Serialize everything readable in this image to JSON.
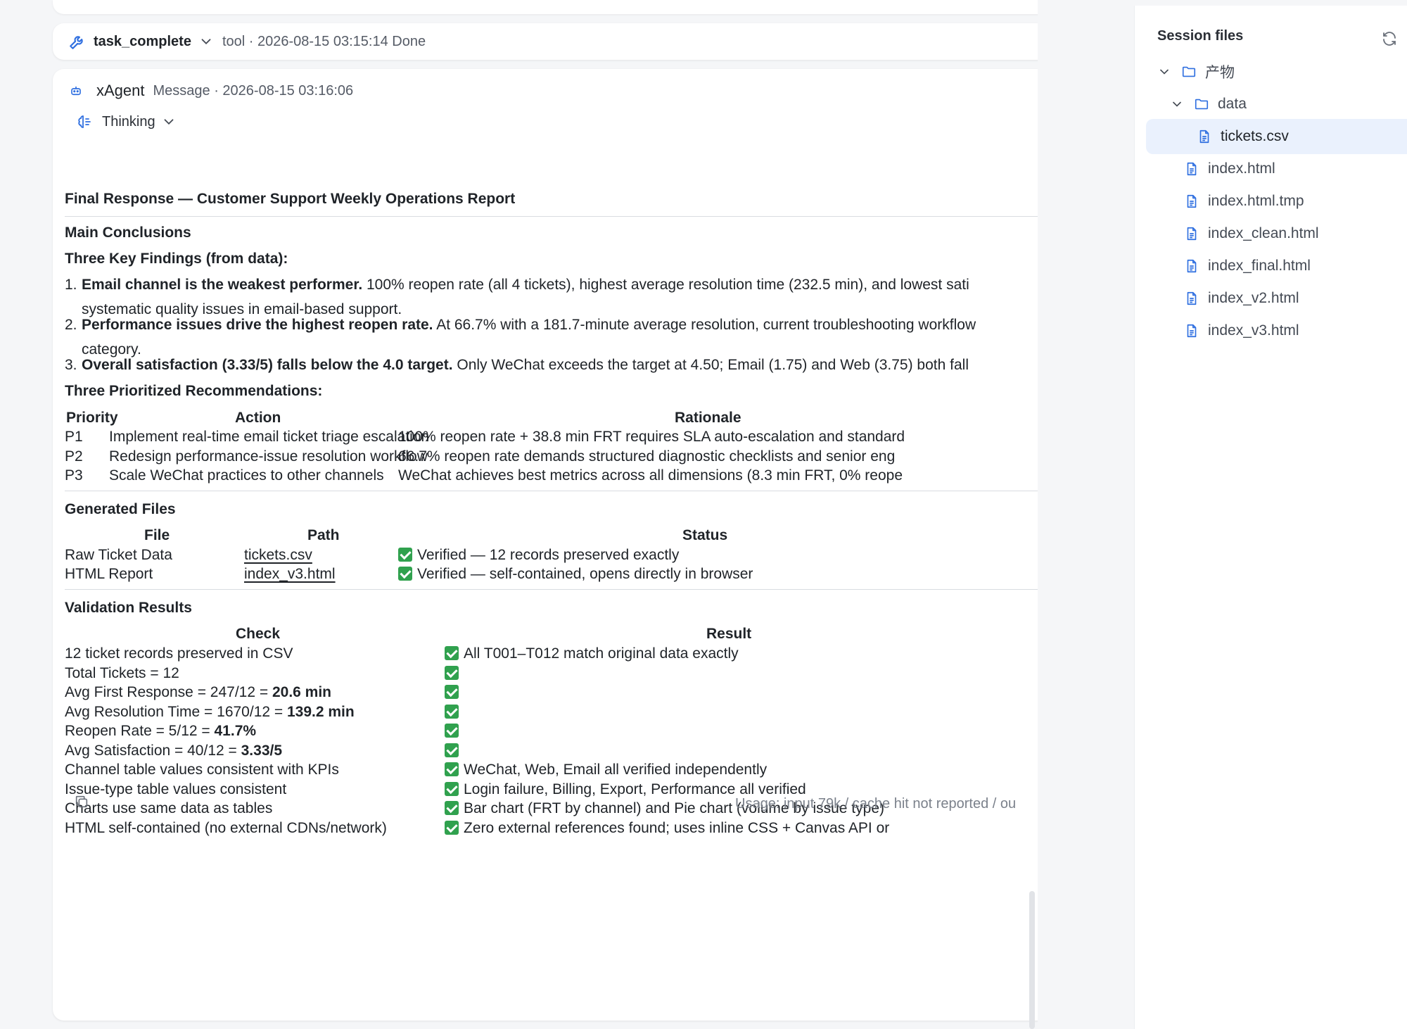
{
  "tool_call": {
    "name": "task_complete",
    "meta": "tool · 2026-08-15 03:15:14  Done"
  },
  "message": {
    "agent": "xAgent",
    "meta": "Message · 2026-08-15 03:16:06",
    "thinking_label": "Thinking",
    "title": "Final Response — Customer Support Weekly Operations Report",
    "main_conclusions": "Main Conclusions",
    "findings_heading": "Three Key Findings (from data):",
    "findings": [
      {
        "num": "1.",
        "bold": "Email channel is the weakest performer.",
        "text": " 100% reopen rate (all 4 tickets), highest average resolution time (232.5 min), and lowest sati",
        "cont": "systematic quality issues in email-based support."
      },
      {
        "num": "2.",
        "bold": "Performance issues drive the highest reopen rate.",
        "text": " At 66.7% with a 181.7-minute average resolution, current troubleshooting workflow",
        "cont": "category."
      },
      {
        "num": "3.",
        "bold": "Overall satisfaction (3.33/5) falls below the 4.0 target.",
        "text": " Only WeChat exceeds the target at 4.50; Email (1.75) and Web (3.75) both fall",
        "cont": ""
      }
    ],
    "recs_heading": "Three Prioritized Recommendations:",
    "recs_headers": [
      "Priority",
      "Action",
      "Rationale"
    ],
    "recs": [
      {
        "priority": "P1",
        "action": "Implement real-time email ticket triage escalation",
        "rationale": "100% reopen rate + 38.8 min FRT requires SLA auto-escalation and standard"
      },
      {
        "priority": "P2",
        "action": "Redesign performance-issue resolution workflow",
        "rationale": "66.7% reopen rate demands structured diagnostic checklists and senior eng"
      },
      {
        "priority": "P3",
        "action": "Scale WeChat practices to other channels",
        "rationale": "WeChat achieves best metrics across all dimensions (8.3 min FRT, 0% reope"
      }
    ],
    "files_heading": "Generated Files",
    "files_headers": [
      "File",
      "Path",
      "Status"
    ],
    "files": [
      {
        "file": "Raw Ticket Data",
        "path": "tickets.csv",
        "status": "Verified — 12 records preserved exactly"
      },
      {
        "file": "HTML Report",
        "path": "index_v3.html",
        "status": "Verified — self-contained, opens directly in browser"
      }
    ],
    "validation_heading": "Validation Results",
    "validation_headers": [
      "Check",
      "Result"
    ],
    "validation": [
      {
        "check": "12 ticket records preserved in CSV",
        "check_bold": "",
        "result": "All T001–T012 match original data exactly"
      },
      {
        "check": "Total Tickets = 12",
        "check_bold": "",
        "result": ""
      },
      {
        "check": "Avg First Response = 247/12 = ",
        "check_bold": "20.6 min",
        "result": ""
      },
      {
        "check": "Avg Resolution Time = 1670/12 = ",
        "check_bold": "139.2 min",
        "result": ""
      },
      {
        "check": "Reopen Rate = 5/12 = ",
        "check_bold": "41.7%",
        "result": ""
      },
      {
        "check": "Avg Satisfaction = 40/12 = ",
        "check_bold": "3.33/5",
        "result": ""
      },
      {
        "check": "Channel table values consistent with KPIs",
        "check_bold": "",
        "result": "WeChat, Web, Email all verified independently"
      },
      {
        "check": "Issue-type table values consistent",
        "check_bold": "",
        "result": "Login failure, Billing, Export, Performance all verified"
      },
      {
        "check": "Charts use same data as tables",
        "check_bold": "",
        "result": "Bar chart (FRT by channel) and Pie chart (volume by issue type) "
      },
      {
        "check": "HTML self-contained (no external CDNs/network)",
        "check_bold": "",
        "result": "Zero external references found; uses inline CSS + Canvas API or"
      }
    ],
    "usage": "Usage: input 79k / cache hit not reported / ou"
  },
  "panel": {
    "title": "Session files",
    "tree": [
      {
        "label": "产物",
        "kind": "folder"
      },
      {
        "label": "data",
        "kind": "folder"
      },
      {
        "label": "tickets.csv",
        "kind": "file",
        "selected": true
      },
      {
        "label": "index.html",
        "kind": "file"
      },
      {
        "label": "index.html.tmp",
        "kind": "file"
      },
      {
        "label": "index_clean.html",
        "kind": "file"
      },
      {
        "label": "index_final.html",
        "kind": "file"
      },
      {
        "label": "index_v2.html",
        "kind": "file"
      },
      {
        "label": "index_v3.html",
        "kind": "file"
      }
    ]
  },
  "icons": {
    "tool": "wrench-icon",
    "agent": "bot-icon",
    "thinking": "brain-icon",
    "copy": "copy-icon",
    "refresh": "refresh-icon",
    "folder": "folder-icon",
    "file": "file-icon",
    "check": "check-icon"
  },
  "colors": {
    "accent": "#2f6fe0",
    "check": "#30a14e",
    "selected_bg": "#eaf1fd"
  }
}
